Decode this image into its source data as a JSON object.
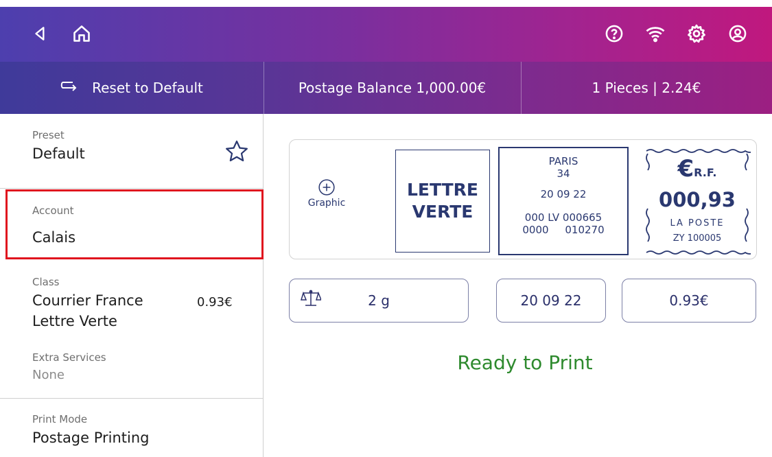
{
  "header": {
    "back_icon": "back-arrow-icon",
    "home_icon": "home-icon",
    "help_icon": "help-icon",
    "wifi_icon": "wifi-icon",
    "settings_icon": "gear-icon",
    "account_icon": "user-icon"
  },
  "subbar": {
    "reset_label": "Reset to Default",
    "balance_label": "Postage Balance 1,000.00€",
    "pieces_label": "1 Pieces | 2.24€"
  },
  "left": {
    "preset": {
      "label": "Preset",
      "value": "Default"
    },
    "account": {
      "label": "Account",
      "value": "Calais"
    },
    "class": {
      "label": "Class",
      "value_line1": "Courrier France",
      "value_line2": "Lettre Verte",
      "price": "0.93€"
    },
    "extra": {
      "label": "Extra Services",
      "value": "None"
    },
    "print_mode": {
      "label": "Print Mode",
      "value": "Postage Printing"
    }
  },
  "stamp": {
    "graphic_label": "Graphic",
    "class_line1": "LETTRE",
    "class_line2": "VERTE",
    "city": "PARIS",
    "dept": "34",
    "date": "20 09 22",
    "code_line1": "000 LV 000665",
    "code_line2": "0000     010270",
    "rf": "€",
    "rf_suffix": "R.F.",
    "amount": "000,93",
    "la_poste": "LA POSTE",
    "zy": "ZY 100005"
  },
  "controls": {
    "weight": "2 g",
    "date": "20 09 22",
    "price": "0.93€"
  },
  "status": {
    "text": "Ready to Print"
  },
  "colors": {
    "highlight": "#e0141e",
    "ready": "#2e8a2e",
    "stamp_blue": "#2a3870"
  }
}
